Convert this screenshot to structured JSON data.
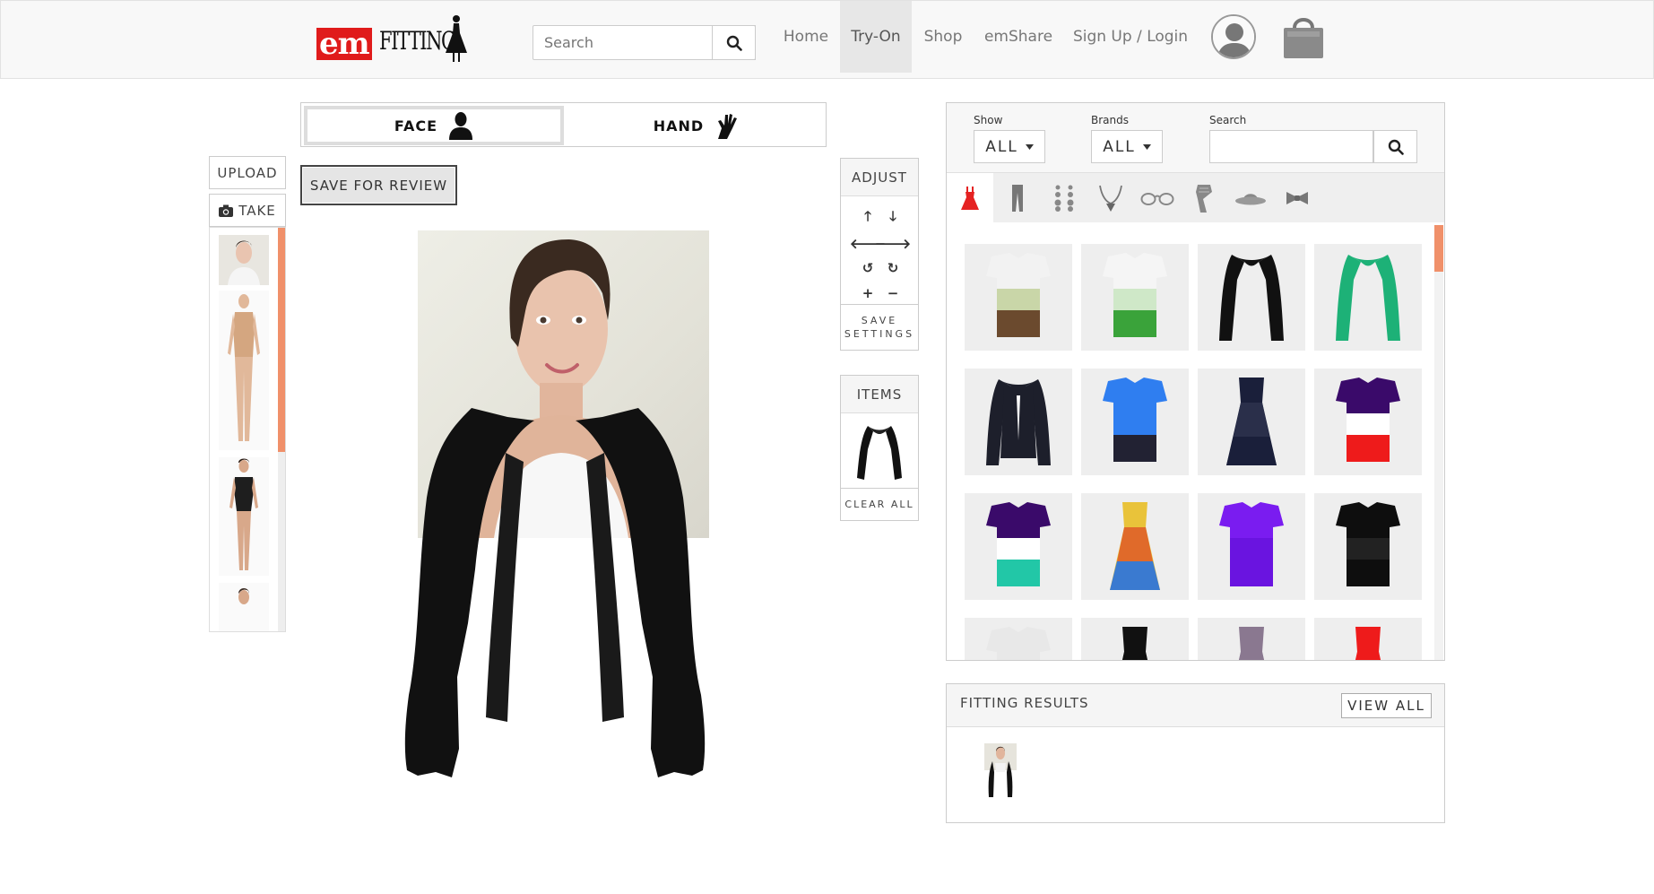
{
  "navbar": {
    "logo_alt": "emFitting",
    "search_placeholder": "Search",
    "items": [
      {
        "label": "Home"
      },
      {
        "label": "Try-On",
        "active": true
      },
      {
        "label": "Shop"
      },
      {
        "label": "emShare"
      },
      {
        "label": "Sign Up / Login"
      }
    ],
    "icons": {
      "search": "search-icon",
      "avatar": "user-avatar-icon",
      "cart": "shopping-bag-icon"
    }
  },
  "mode_tabs": {
    "face": {
      "label": "FACE",
      "active": true,
      "icon": "person-silhouette-icon"
    },
    "hand": {
      "label": "HAND",
      "icon": "hand-icon"
    }
  },
  "left_panel": {
    "upload_label": "UPLOAD",
    "take_label": "TAKE",
    "take_icon": "camera-icon",
    "save_review_label": "SAVE FOR REVIEW",
    "models": [
      {
        "name": "model-headshot"
      },
      {
        "name": "model-nude-bodysuit"
      },
      {
        "name": "model-black-swimsuit"
      },
      {
        "name": "model-partial"
      }
    ]
  },
  "adjust": {
    "title": "ADJUST",
    "buttons": [
      {
        "name": "move-up",
        "glyph": "🡑"
      },
      {
        "name": "move-down",
        "glyph": "🡓"
      },
      {
        "name": "move-left",
        "glyph": "🡐"
      },
      {
        "name": "move-right",
        "glyph": "🡒"
      },
      {
        "name": "rotate-left",
        "glyph": "↺"
      },
      {
        "name": "rotate-right",
        "glyph": "↻"
      },
      {
        "name": "zoom-in",
        "glyph": "+"
      },
      {
        "name": "zoom-out",
        "glyph": "−"
      }
    ],
    "save_label": "SAVE SETTINGS"
  },
  "items_panel": {
    "title": "ITEMS",
    "clear_label": "CLEAR ALL"
  },
  "catalog": {
    "show_label": "Show",
    "show_value": "ALL",
    "brands_label": "Brands",
    "brands_value": "ALL",
    "search_label": "Search",
    "search_value": "",
    "categories": [
      {
        "name": "dress",
        "icon": "dress-icon",
        "active": true
      },
      {
        "name": "pants",
        "icon": "pants-icon"
      },
      {
        "name": "earrings",
        "icon": "earrings-icon"
      },
      {
        "name": "necklace",
        "icon": "necklace-icon"
      },
      {
        "name": "glasses",
        "icon": "glasses-icon"
      },
      {
        "name": "scarf",
        "icon": "scarf-icon"
      },
      {
        "name": "hat",
        "icon": "hat-icon"
      },
      {
        "name": "bowtie",
        "icon": "bowtie-icon"
      }
    ],
    "products": [
      {
        "name": "sleeveless-ombre-top-brown",
        "colors": [
          "#f2f2f2",
          "#c9d6a8",
          "#6b4a2e"
        ]
      },
      {
        "name": "sleeveless-layered-top-green",
        "colors": [
          "#f5f5f5",
          "#cfe8c8",
          "#3aa33a"
        ]
      },
      {
        "name": "black-shrug-cardigan",
        "colors": [
          "#111111",
          "#111111",
          "#111111"
        ]
      },
      {
        "name": "green-cardigan",
        "colors": [
          "#1db177",
          "#1db177",
          "#1db177"
        ]
      },
      {
        "name": "black-blazer",
        "colors": [
          "#1d1f2b",
          "#1d1f2b",
          "#1d1f2b"
        ]
      },
      {
        "name": "blue-draped-top",
        "colors": [
          "#2f7ef0",
          "#2f7ef0",
          "#223"
        ]
      },
      {
        "name": "floral-dress-dark",
        "colors": [
          "#1a1f3a",
          "#2a2f4a",
          "#1a1f3a"
        ]
      },
      {
        "name": "colorblock-top-red",
        "colors": [
          "#3a0a6a",
          "#ffffff",
          "#ee1b1b"
        ]
      },
      {
        "name": "colorblock-top-teal",
        "colors": [
          "#3a0a6a",
          "#ffffff",
          "#22c7a7"
        ]
      },
      {
        "name": "printed-dress-multicolor",
        "colors": [
          "#e9c33a",
          "#e06a2a",
          "#3a7ad0"
        ]
      },
      {
        "name": "purple-batwing-top",
        "colors": [
          "#7a1cf0",
          "#6a14e0",
          "#6a14e0"
        ]
      },
      {
        "name": "black-sheer-top",
        "colors": [
          "#0e0e0e",
          "#222222",
          "#0e0e0e"
        ]
      },
      {
        "name": "white-blouse",
        "colors": [
          "#e8e8e8",
          "#f5f5f5",
          "#e8e8e8"
        ]
      },
      {
        "name": "black-gown",
        "colors": [
          "#111111",
          "#111111",
          "#111111"
        ]
      },
      {
        "name": "lace-dress-mauve",
        "colors": [
          "#8a7890",
          "#8a7890",
          "#8a7890"
        ]
      },
      {
        "name": "red-strapless-dress",
        "colors": [
          "#ee1b1b",
          "#ee1b1b",
          "#ee1b1b"
        ]
      }
    ]
  },
  "results": {
    "title": "FITTING RESULTS",
    "view_all_label": "VIEW ALL"
  },
  "colors": {
    "accent": "#f0906a",
    "logo_red": "#e01b1b",
    "nav_bg": "#f8f8f8"
  }
}
